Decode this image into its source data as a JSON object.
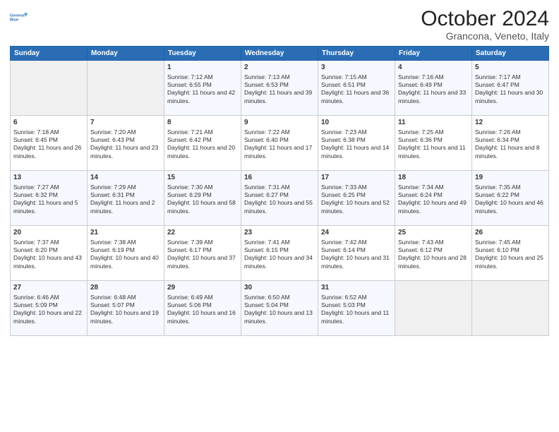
{
  "logo": {
    "line1": "General",
    "line2": "Blue"
  },
  "title": "October 2024",
  "subtitle": "Grancona, Veneto, Italy",
  "days_of_week": [
    "Sunday",
    "Monday",
    "Tuesday",
    "Wednesday",
    "Thursday",
    "Friday",
    "Saturday"
  ],
  "weeks": [
    [
      {
        "day": "",
        "info": ""
      },
      {
        "day": "",
        "info": ""
      },
      {
        "day": "1",
        "info": "Sunrise: 7:12 AM\nSunset: 6:55 PM\nDaylight: 11 hours and 42 minutes."
      },
      {
        "day": "2",
        "info": "Sunrise: 7:13 AM\nSunset: 6:53 PM\nDaylight: 11 hours and 39 minutes."
      },
      {
        "day": "3",
        "info": "Sunrise: 7:15 AM\nSunset: 6:51 PM\nDaylight: 11 hours and 36 minutes."
      },
      {
        "day": "4",
        "info": "Sunrise: 7:16 AM\nSunset: 6:49 PM\nDaylight: 11 hours and 33 minutes."
      },
      {
        "day": "5",
        "info": "Sunrise: 7:17 AM\nSunset: 6:47 PM\nDaylight: 11 hours and 30 minutes."
      }
    ],
    [
      {
        "day": "6",
        "info": "Sunrise: 7:18 AM\nSunset: 6:45 PM\nDaylight: 11 hours and 26 minutes."
      },
      {
        "day": "7",
        "info": "Sunrise: 7:20 AM\nSunset: 6:43 PM\nDaylight: 11 hours and 23 minutes."
      },
      {
        "day": "8",
        "info": "Sunrise: 7:21 AM\nSunset: 6:42 PM\nDaylight: 11 hours and 20 minutes."
      },
      {
        "day": "9",
        "info": "Sunrise: 7:22 AM\nSunset: 6:40 PM\nDaylight: 11 hours and 17 minutes."
      },
      {
        "day": "10",
        "info": "Sunrise: 7:23 AM\nSunset: 6:38 PM\nDaylight: 11 hours and 14 minutes."
      },
      {
        "day": "11",
        "info": "Sunrise: 7:25 AM\nSunset: 6:36 PM\nDaylight: 11 hours and 11 minutes."
      },
      {
        "day": "12",
        "info": "Sunrise: 7:26 AM\nSunset: 6:34 PM\nDaylight: 11 hours and 8 minutes."
      }
    ],
    [
      {
        "day": "13",
        "info": "Sunrise: 7:27 AM\nSunset: 6:32 PM\nDaylight: 11 hours and 5 minutes."
      },
      {
        "day": "14",
        "info": "Sunrise: 7:29 AM\nSunset: 6:31 PM\nDaylight: 11 hours and 2 minutes."
      },
      {
        "day": "15",
        "info": "Sunrise: 7:30 AM\nSunset: 6:29 PM\nDaylight: 10 hours and 58 minutes."
      },
      {
        "day": "16",
        "info": "Sunrise: 7:31 AM\nSunset: 6:27 PM\nDaylight: 10 hours and 55 minutes."
      },
      {
        "day": "17",
        "info": "Sunrise: 7:33 AM\nSunset: 6:25 PM\nDaylight: 10 hours and 52 minutes."
      },
      {
        "day": "18",
        "info": "Sunrise: 7:34 AM\nSunset: 6:24 PM\nDaylight: 10 hours and 49 minutes."
      },
      {
        "day": "19",
        "info": "Sunrise: 7:35 AM\nSunset: 6:22 PM\nDaylight: 10 hours and 46 minutes."
      }
    ],
    [
      {
        "day": "20",
        "info": "Sunrise: 7:37 AM\nSunset: 6:20 PM\nDaylight: 10 hours and 43 minutes."
      },
      {
        "day": "21",
        "info": "Sunrise: 7:38 AM\nSunset: 6:19 PM\nDaylight: 10 hours and 40 minutes."
      },
      {
        "day": "22",
        "info": "Sunrise: 7:39 AM\nSunset: 6:17 PM\nDaylight: 10 hours and 37 minutes."
      },
      {
        "day": "23",
        "info": "Sunrise: 7:41 AM\nSunset: 6:15 PM\nDaylight: 10 hours and 34 minutes."
      },
      {
        "day": "24",
        "info": "Sunrise: 7:42 AM\nSunset: 6:14 PM\nDaylight: 10 hours and 31 minutes."
      },
      {
        "day": "25",
        "info": "Sunrise: 7:43 AM\nSunset: 6:12 PM\nDaylight: 10 hours and 28 minutes."
      },
      {
        "day": "26",
        "info": "Sunrise: 7:45 AM\nSunset: 6:10 PM\nDaylight: 10 hours and 25 minutes."
      }
    ],
    [
      {
        "day": "27",
        "info": "Sunrise: 6:46 AM\nSunset: 5:09 PM\nDaylight: 10 hours and 22 minutes."
      },
      {
        "day": "28",
        "info": "Sunrise: 6:48 AM\nSunset: 5:07 PM\nDaylight: 10 hours and 19 minutes."
      },
      {
        "day": "29",
        "info": "Sunrise: 6:49 AM\nSunset: 5:06 PM\nDaylight: 10 hours and 16 minutes."
      },
      {
        "day": "30",
        "info": "Sunrise: 6:50 AM\nSunset: 5:04 PM\nDaylight: 10 hours and 13 minutes."
      },
      {
        "day": "31",
        "info": "Sunrise: 6:52 AM\nSunset: 5:03 PM\nDaylight: 10 hours and 11 minutes."
      },
      {
        "day": "",
        "info": ""
      },
      {
        "day": "",
        "info": ""
      }
    ]
  ]
}
